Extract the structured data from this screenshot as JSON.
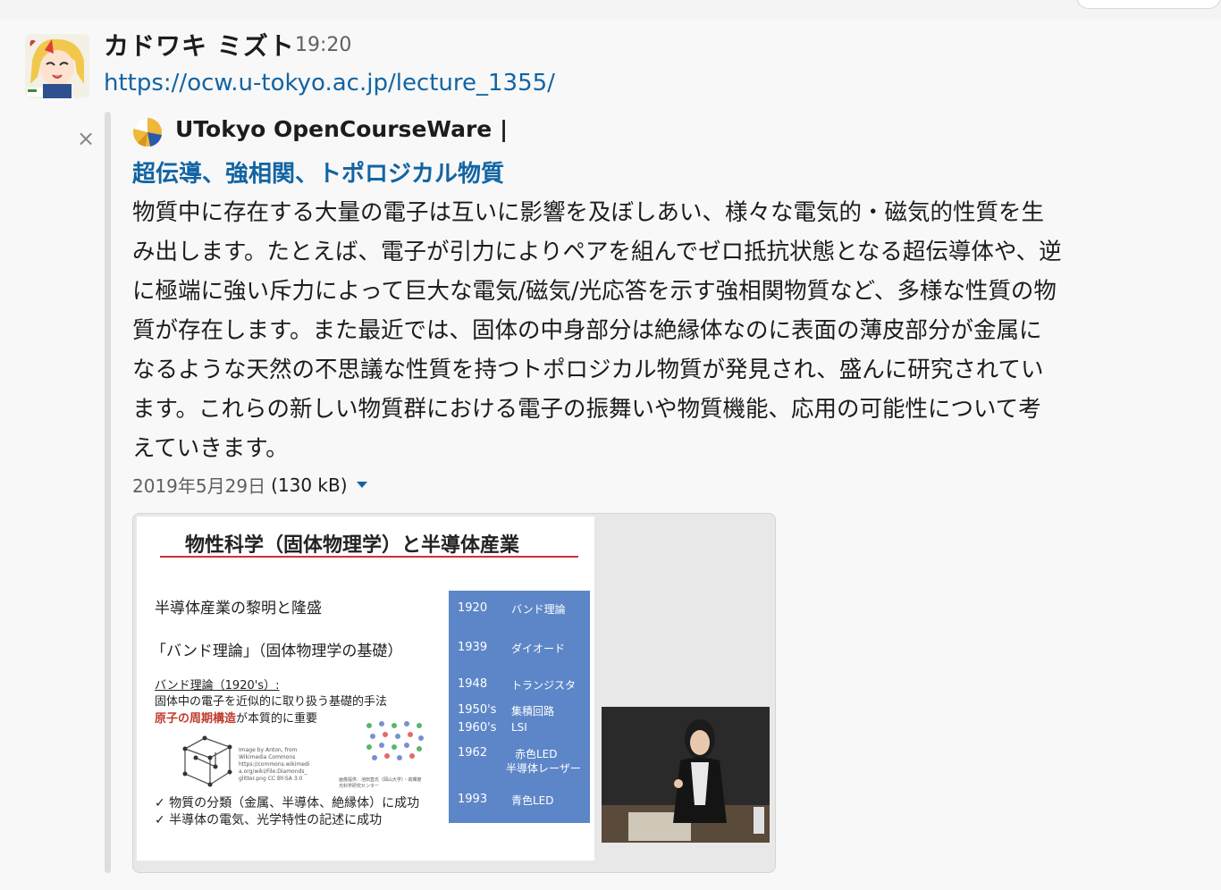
{
  "message": {
    "sender": "カドワキ ミズト",
    "time": "19:20",
    "link": "https://ocw.u-tokyo.ac.jp/lecture_1355/"
  },
  "preview": {
    "dismiss": "×",
    "site_name": "UTokyo OpenCourseWare |",
    "title": "超伝導、強相関、トポロジカル物質",
    "description_lines": [
      "物質中に存在する大量の電子は互いに影響を及ぼしあい、様々な電気的・磁気的性質を生",
      "み出します。たとえば、電子が引力によりペアを組んでゼロ抵抗状態となる超伝導体や、逆",
      "に極端に強い斥力によって巨大な電気/磁気/光応答を示す強相関物質など、多様な性質の物",
      "質が存在します。また最近では、固体の中身部分は絶縁体なのに表面の薄皮部分が金属に",
      "なるような天然の不思議な性質を持つトポロジカル物質が発見され、盛んに研究されてい",
      "ます。これらの新しい物質群における電子の振舞いや物質機能、応用の可能性について考",
      "えていきます。"
    ],
    "date": "2019年5月29日",
    "size": "(130 kB)"
  },
  "slide": {
    "title": "物性科学（固体物理学）と半導体産業",
    "heading1": "半導体産業の黎明と隆盛",
    "heading2": "「バンド理論」（固体物理学の基礎）",
    "band_label": "バンド理論（1920's）:",
    "band_desc": "固体中の電子を近似的に取り扱う基礎的手法",
    "emphasis": "原子の周期構造",
    "emphasis_rest": "が本質的に重要",
    "credit_left": [
      "Image by Anton, from",
      "Wikimedia Commons",
      "https://commons.wikimedi",
      "a.org/wiki/File:Diamonds_",
      "glitter.png CC BY-SA 3.0"
    ],
    "credit_right": [
      "画像提供：池田直氏（岡山大学）・高輝度",
      "光科学研究センター"
    ],
    "checks": [
      "✓  物質の分類（金属、半導体、絶縁体）に成功",
      "✓  半導体の電気、光学特性の記述に成功"
    ],
    "timeline": [
      {
        "year": "1920",
        "event": "バンド理論"
      },
      {
        "year": "1939",
        "event": "ダイオード"
      },
      {
        "year": "1948",
        "event": "トランジスタ"
      },
      {
        "year": "1950's",
        "event": "集積回路"
      },
      {
        "year": "1960's",
        "event": "LSI"
      },
      {
        "year": "1962",
        "event": "赤色LED"
      },
      {
        "year": "",
        "event": "半導体レーザー"
      },
      {
        "year": "1993",
        "event": "青色LED"
      }
    ]
  },
  "colors": {
    "link": "#1264a3",
    "timeline_bg": "#5d86c8",
    "emphasis": "#c0392b",
    "background": "#f8f8f8"
  }
}
